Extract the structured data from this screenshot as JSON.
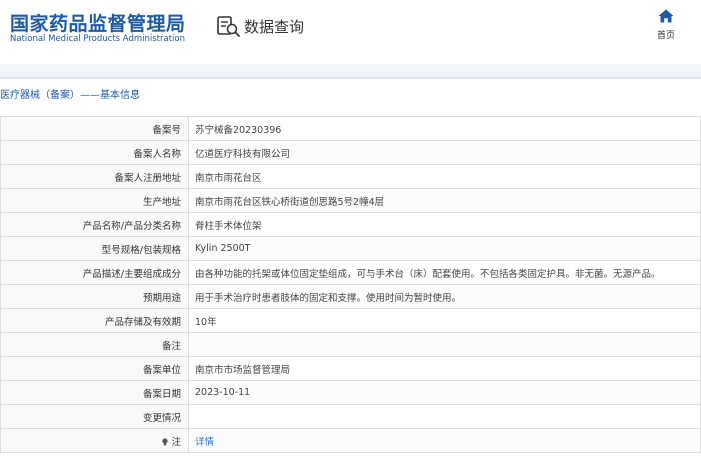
{
  "header": {
    "logo_cn": "国家药品监督管理局",
    "logo_en": "National Medical Products Administration",
    "search_label": "数据查询",
    "home_label": "首页",
    "brand_color": "#1d5ba7"
  },
  "section": {
    "title": "医疗器械（备案）——基本信息"
  },
  "rows": [
    {
      "label": "备案号",
      "value": "苏宁械备20230396"
    },
    {
      "label": "备案人名称",
      "value": "亿道医疗科技有限公司"
    },
    {
      "label": "备案人注册地址",
      "value": "南京市雨花台区"
    },
    {
      "label": "生产地址",
      "value": "南京市雨花台区铁心桥街道创思路5号2幢4层"
    },
    {
      "label": "产品名称/产品分类名称",
      "value": "脊柱手术体位架"
    },
    {
      "label": "型号规格/包装规格",
      "value": "Kylin 2500T"
    },
    {
      "label": "产品描述/主要组成成分",
      "value": "由各种功能的托架或体位固定垫组成，可与手术台（床）配套使用。不包括各类固定护具。非无菌。无源产品。"
    },
    {
      "label": "预期用途",
      "value": "用于手术治疗时患者肢体的固定和支撑。使用时间为暂时使用。"
    },
    {
      "label": "产品存储及有效期",
      "value": "10年"
    },
    {
      "label": "备注",
      "value": ""
    },
    {
      "label": "备案单位",
      "value": "南京市市场监督管理局"
    },
    {
      "label": "备案日期",
      "value": "2023-10-11"
    },
    {
      "label": "变更情况",
      "value": ""
    },
    {
      "label": "注",
      "value": "详情"
    }
  ]
}
